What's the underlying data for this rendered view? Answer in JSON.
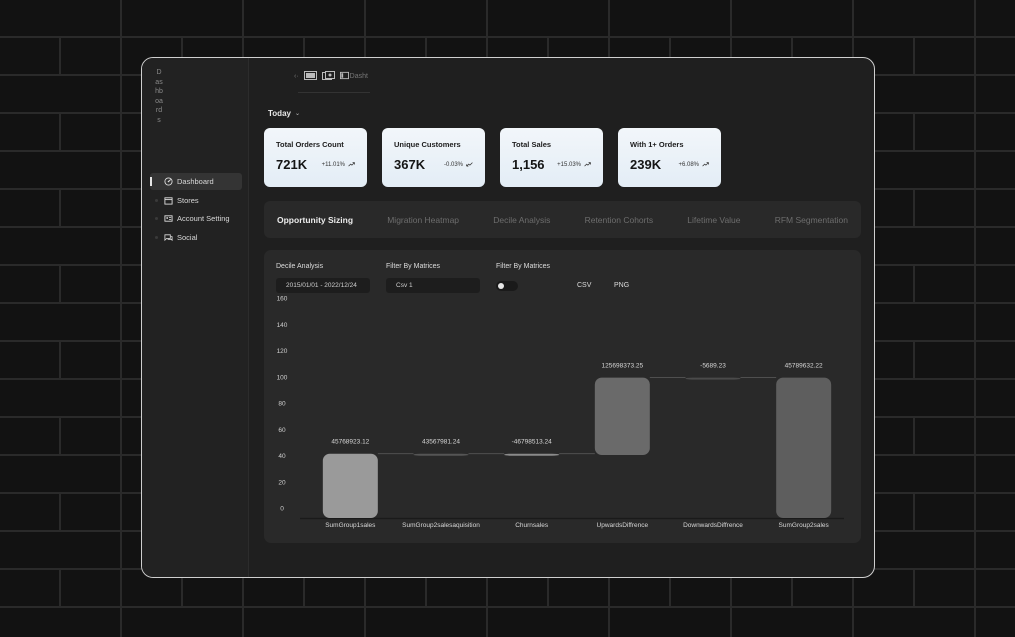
{
  "sidebar": {
    "title": "Dashboards",
    "items": [
      {
        "label": "Dashboard",
        "icon": "dashboard-icon",
        "active": true
      },
      {
        "label": "Stores",
        "icon": "store-icon",
        "active": false
      },
      {
        "label": "Account Setting",
        "icon": "account-icon",
        "active": false
      },
      {
        "label": "Social",
        "icon": "chat-icon",
        "active": false
      }
    ]
  },
  "topbar": {
    "back": "‹·",
    "path_text": "Dasht"
  },
  "filter_period": "Today",
  "cards": [
    {
      "title": "Total Orders Count",
      "value": "721K",
      "delta": "+11.01%",
      "trend": "up"
    },
    {
      "title": "Unique Customers",
      "value": "367K",
      "delta": "-0.03%",
      "trend": "down"
    },
    {
      "title": "Total Sales",
      "value": "1,156",
      "delta": "+15.03%",
      "trend": "up"
    },
    {
      "title": "With 1+ Orders",
      "value": "239K",
      "delta": "+6.08%",
      "trend": "up"
    }
  ],
  "tabs": [
    {
      "label": "Opportunity Sizing",
      "active": true
    },
    {
      "label": "Migration Heatmap",
      "active": false
    },
    {
      "label": "Decile Analysis",
      "active": false
    },
    {
      "label": "Retention Cohorts",
      "active": false
    },
    {
      "label": "Lifetime Value",
      "active": false
    },
    {
      "label": "RFM Segmentation",
      "active": false
    }
  ],
  "filters": {
    "decile_label": "Decile Analysis",
    "date_range": "2015/01/01 - 2022/12/24",
    "matrix_label_1": "Filter By Matrices",
    "matrix_value": "Csv 1",
    "matrix_label_2": "Filter By Matrices",
    "export_csv": "CSV",
    "export_png": "PNG"
  },
  "chart_data": {
    "type": "bar",
    "subtype": "waterfall",
    "yticks": [
      0,
      20,
      40,
      60,
      80,
      100,
      120,
      140,
      160
    ],
    "ylim": [
      0,
      160
    ],
    "grid": false,
    "categories": [
      "SumGroup1sales",
      "SumGroup2salesaquisition",
      "Churnsales",
      "UpwardsDiffrence",
      "DownwardsDiffrence",
      "SumGroup2sales"
    ],
    "data_labels": [
      "45768923.12",
      "43567981.24",
      "-46798513.24",
      "125698373.25",
      "-5689.23",
      "45789632.22"
    ],
    "bars": [
      {
        "base": 0,
        "top": 49,
        "color": "#9a9a9a"
      },
      {
        "base": 48,
        "top": 49,
        "color": "#555555"
      },
      {
        "base": 48,
        "top": 49,
        "color": "#8a8a8a"
      },
      {
        "base": 48,
        "top": 107,
        "color": "#6a6a6a"
      },
      {
        "base": 106,
        "top": 107,
        "color": "#4a4a4a"
      },
      {
        "base": 0,
        "top": 107,
        "color": "#5e5e5e"
      }
    ]
  }
}
